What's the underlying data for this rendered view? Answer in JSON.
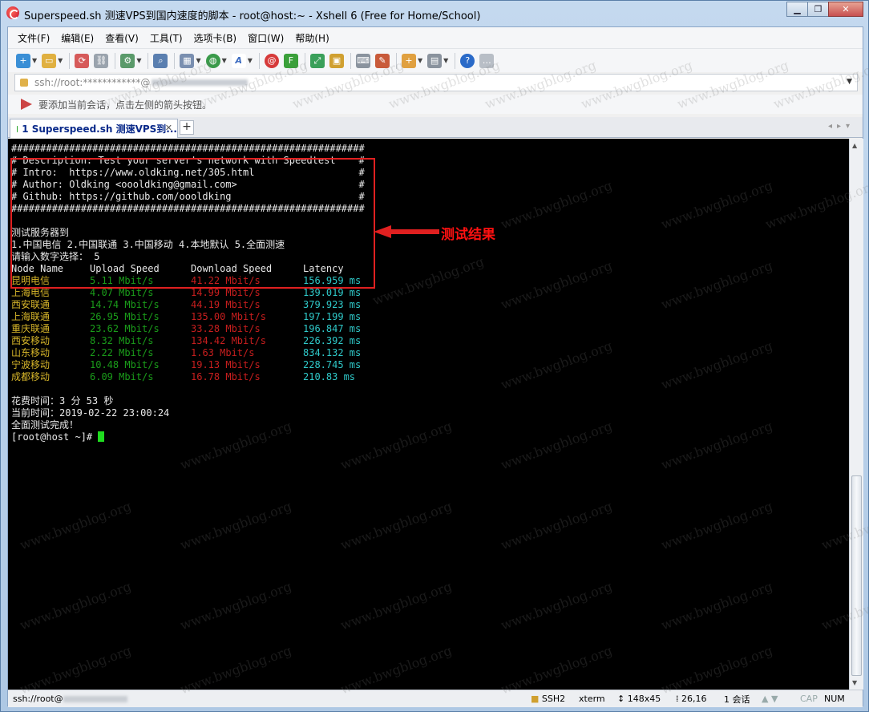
{
  "window": {
    "title": "Superspeed.sh 测速VPS到国内速度的脚本 - root@host:~ - Xshell 6 (Free for Home/School)",
    "buttons": [
      "minimize",
      "restore",
      "close"
    ]
  },
  "menu": [
    "文件(F)",
    "编辑(E)",
    "查看(V)",
    "工具(T)",
    "选项卡(B)",
    "窗口(W)",
    "帮助(H)"
  ],
  "address": {
    "value": "ssh://root:************@"
  },
  "hint": "要添加当前会话，点击左侧的箭头按钮。",
  "tab": {
    "label": "1 Superspeed.sh 测速VPS到...",
    "add": "+"
  },
  "terminal": {
    "header_lines": [
      "#############################################################",
      "# Description: Test your server's network with Speedtest    #",
      "# Intro:  https://www.oldking.net/305.html                  #",
      "# Author: Oldking <oooldking@gmail.com>                     #",
      "# Github: https://github.com/oooldking                      #",
      "#############################################################",
      ""
    ],
    "prompt_lines": [
      "测试服务器到",
      "1.中国电信 2.中国联通 3.中国移动 4.本地默认 5.全面测速",
      "请输入数字选择： 5"
    ],
    "table_headers": {
      "node": "Node Name",
      "upload": "Upload Speed",
      "download": "Download Speed",
      "latency": "Latency"
    },
    "rows": [
      {
        "node": "昆明电信",
        "upload": "5.11 Mbit/s",
        "download": "41.22 Mbit/s",
        "latency": "156.959 ms"
      },
      {
        "node": "上海电信",
        "upload": "4.07 Mbit/s",
        "download": "14.99 Mbit/s",
        "latency": "139.019 ms"
      },
      {
        "node": "西安联通",
        "upload": "14.74 Mbit/s",
        "download": "44.19 Mbit/s",
        "latency": "379.923 ms"
      },
      {
        "node": "上海联通",
        "upload": "26.95 Mbit/s",
        "download": "135.00 Mbit/s",
        "latency": "197.199 ms"
      },
      {
        "node": "重庆联通",
        "upload": "23.62 Mbit/s",
        "download": "33.28 Mbit/s",
        "latency": "196.847 ms"
      },
      {
        "node": "西安移动",
        "upload": "8.32 Mbit/s",
        "download": "134.42 Mbit/s",
        "latency": "226.392 ms"
      },
      {
        "node": "山东移动",
        "upload": "2.22 Mbit/s",
        "download": "1.63 Mbit/s",
        "latency": "834.132 ms"
      },
      {
        "node": "宁波移动",
        "upload": "10.48 Mbit/s",
        "download": "19.13 Mbit/s",
        "latency": "228.745 ms"
      },
      {
        "node": "成都移动",
        "upload": "6.09 Mbit/s",
        "download": "16.78 Mbit/s",
        "latency": "210.83 ms"
      }
    ],
    "footer_lines": [
      "花费时间：3 分 53 秒",
      "当前时间：2019-02-22 23:00:24",
      "全面测试完成！"
    ],
    "prompt": "[root@host ~]# ",
    "annotation": "测试结果"
  },
  "status": {
    "connection": "ssh://root@",
    "protocol": "SSH2",
    "terminal_type": "xterm",
    "size": "148x45",
    "cursor": "26,16",
    "sessions": "1 会话",
    "caps": "CAP",
    "num": "NUM"
  },
  "watermark": "www.bwgblog.org",
  "colors": {
    "node": "#d7b62a",
    "upload": "#1a9c1a",
    "download": "#c81e1e",
    "latency": "#2fc9c9",
    "highlight": "#e02020",
    "cursor": "#1fdc1f"
  }
}
